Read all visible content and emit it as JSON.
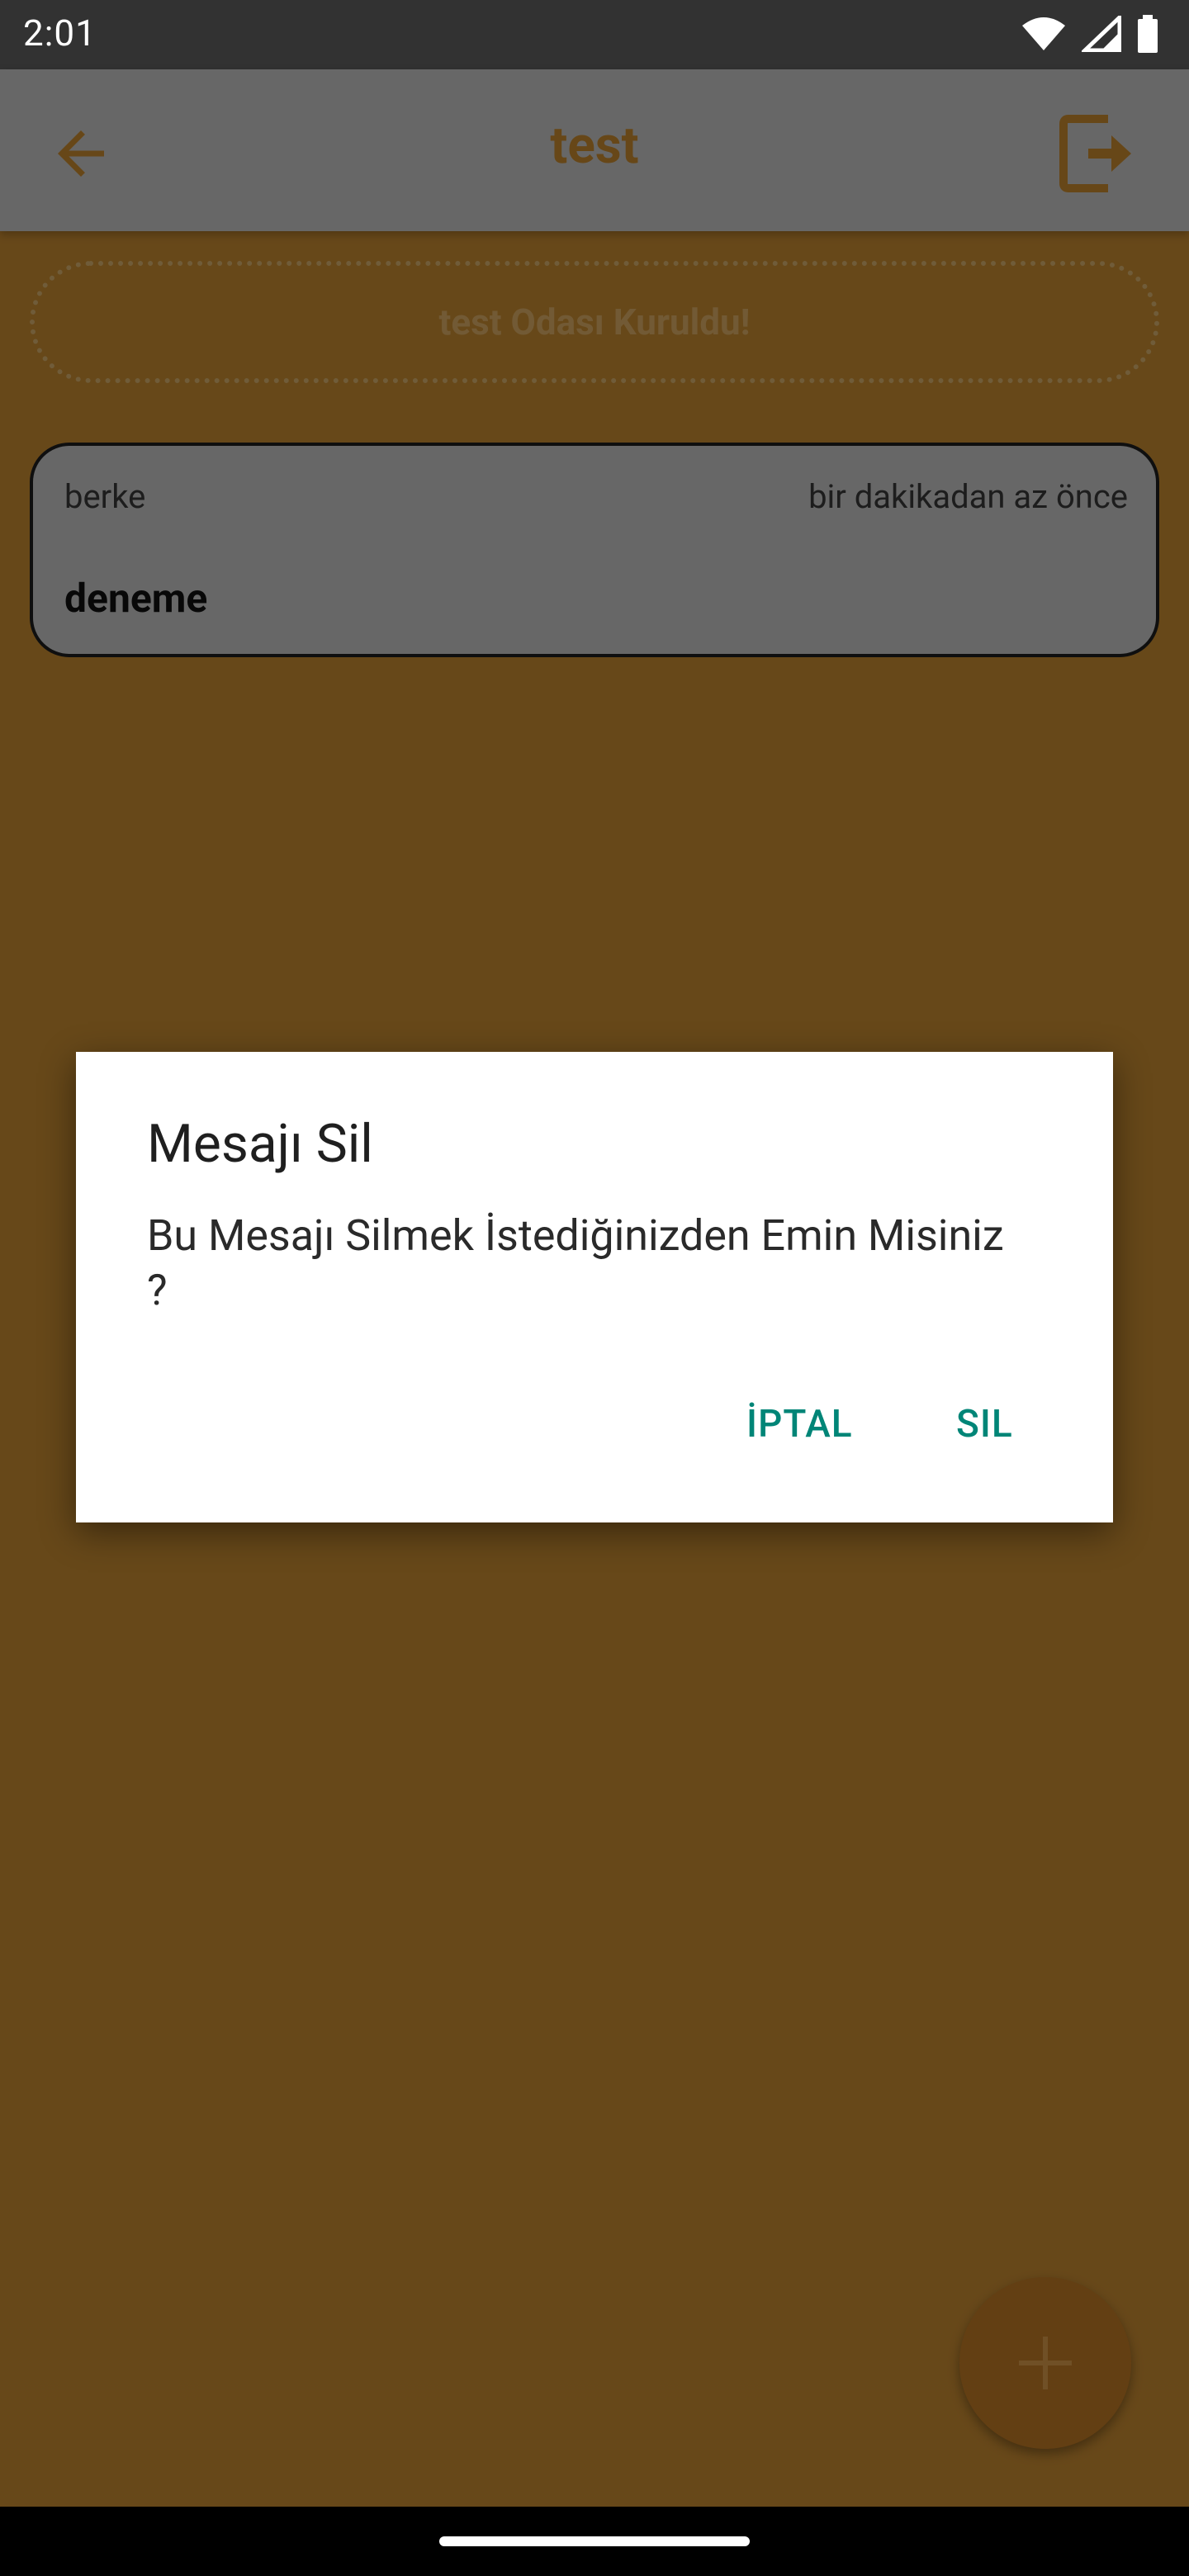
{
  "status_bar": {
    "time": "2:01",
    "icons": [
      "wifi-icon",
      "signal-icon",
      "battery-icon"
    ]
  },
  "app_bar": {
    "title": "test",
    "back_icon": "arrow-left-icon",
    "logout_icon": "logout-icon"
  },
  "banner": {
    "text": "test Odası Kuruldu!"
  },
  "messages": [
    {
      "author": "berke",
      "time": "bir dakikadan az önce",
      "text": "deneme"
    }
  ],
  "fab": {
    "icon": "plus-icon"
  },
  "dialog": {
    "title": "Mesajı Sil",
    "body": "Bu Mesajı Silmek İstediğinizden Emin Misiniz ?",
    "cancel_label": "İPTAL",
    "delete_label": "SIL"
  },
  "colors": {
    "accent": "#cf8f30",
    "dialog_button": "#008577"
  }
}
